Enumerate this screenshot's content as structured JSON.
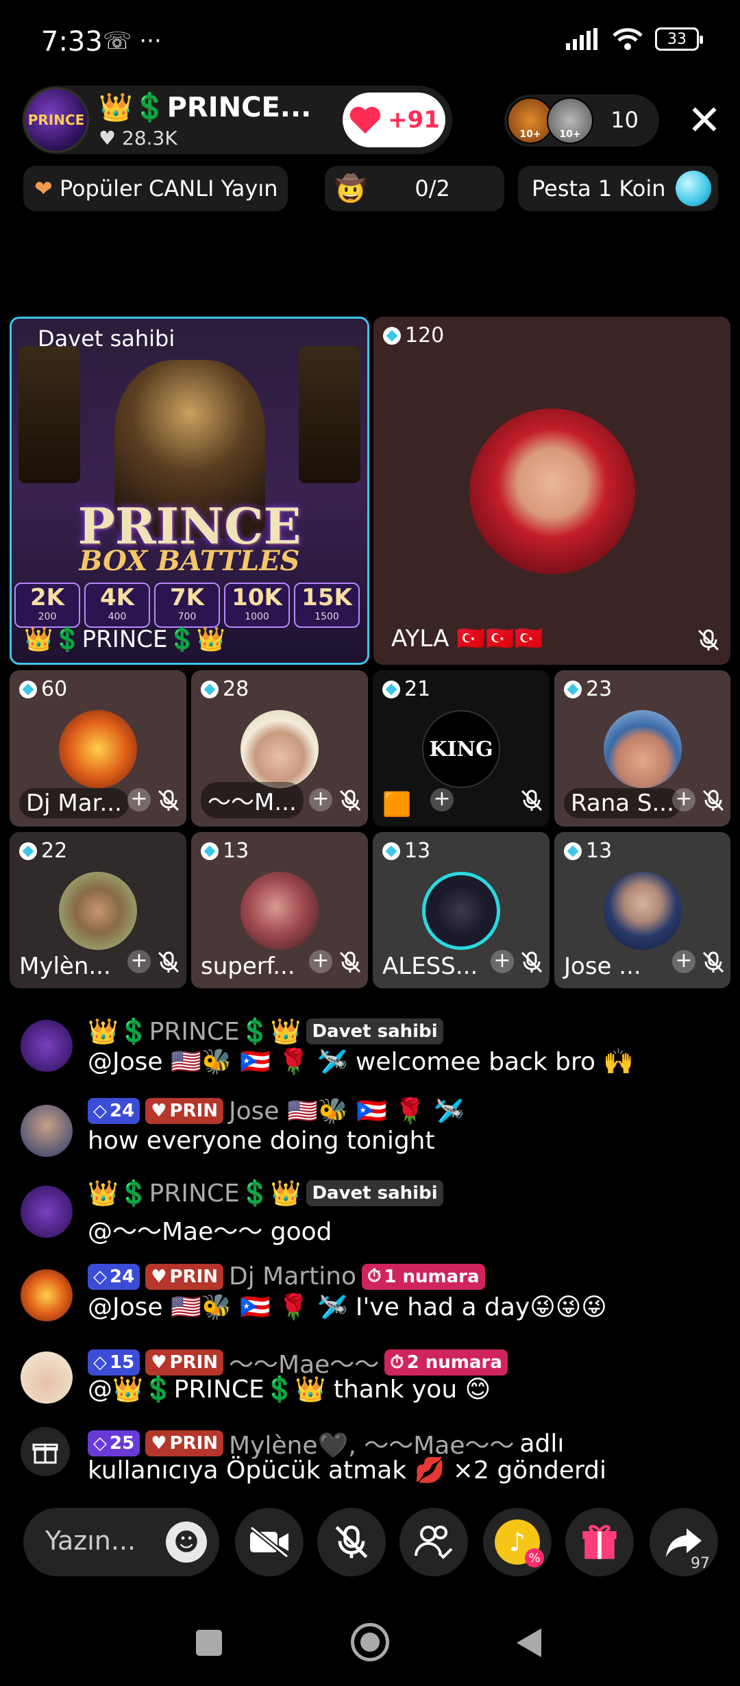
{
  "status_bar": {
    "time": "7:33",
    "extra_icons": "☏ ···",
    "battery": "33"
  },
  "host": {
    "name": "👑💲PRINCE...",
    "likes": "♥ 28.3K",
    "avatar_text": "PRINCE",
    "like_button": "+91"
  },
  "viewers": {
    "badges": [
      "10+",
      "10+"
    ],
    "count": "10"
  },
  "chips": {
    "popular": "Popüler CANLI Yayın",
    "guest_count": "0/2",
    "pesta": "Pesta 1 Koin"
  },
  "host_tile": {
    "label": "Davet sahibi",
    "banner_title": "PRINCE",
    "banner_sub": "BOX BATTLES",
    "tiers": [
      {
        "k": "2K",
        "c": "200"
      },
      {
        "k": "4K",
        "c": "400"
      },
      {
        "k": "7K",
        "c": "700"
      },
      {
        "k": "10K",
        "c": "1000"
      },
      {
        "k": "15K",
        "c": "1500"
      }
    ],
    "name": "👑💲PRINCE💲👑"
  },
  "ayla_tile": {
    "score": "120",
    "name": "AYLA 🇹🇷🇹🇷🇹🇷"
  },
  "guests": [
    {
      "score": "60",
      "name": "Dj Mar..."
    },
    {
      "score": "28",
      "name": "〜〜M..."
    },
    {
      "score": "21",
      "name": "🟧",
      "logo": "KING"
    },
    {
      "score": "23",
      "name": "Rana S..."
    },
    {
      "score": "22",
      "name": "Mylèn..."
    },
    {
      "score": "13",
      "name": "superf..."
    },
    {
      "score": "13",
      "name": "ALESS..."
    },
    {
      "score": "13",
      "name": "Jose ..."
    }
  ],
  "chat": [
    {
      "user": "👑💲PRINCE💲👑",
      "tag": "Davet sahibi",
      "text": "@Jose 🇺🇸🐝 🇵🇷 🌹 🛩️ welcomee back bro 🙌"
    },
    {
      "level": "24",
      "prin": "PRIN",
      "user": "Jose 🇺🇸🐝 🇵🇷 🌹 🛩️",
      "text": "how everyone doing tonight"
    },
    {
      "user": "👑💲PRINCE💲👑",
      "tag": "Davet sahibi",
      "text": "@〜〜Mae〜〜 good"
    },
    {
      "level": "24",
      "prin": "PRIN",
      "user": "Dj Martino",
      "rank": "1 numara",
      "text": "@Jose 🇺🇸🐝 🇵🇷 🌹 🛩️ I've had a day😜😜😜"
    },
    {
      "level": "15",
      "prin": "PRIN",
      "user": "〜〜Mae〜〜",
      "rank": "2 numara",
      "text": "@👑💲PRINCE💲👑 thank you 😊"
    },
    {
      "level": "25",
      "prin": "PRIN",
      "user": "Mylène🖤, 〜〜Mae〜〜",
      "after": "adlı",
      "text": "kullanıcıya Öpücük atmak 💋 ×2 gönderdi"
    }
  ],
  "input": {
    "placeholder": "Yazın..."
  },
  "share_count": "97",
  "colors": {
    "accent_cyan": "#3cc7e8",
    "like_red": "#ff2d55",
    "prin_red": "#b5362a",
    "level_blue": "#3b4cd6",
    "rank_pink": "#d0245f"
  }
}
